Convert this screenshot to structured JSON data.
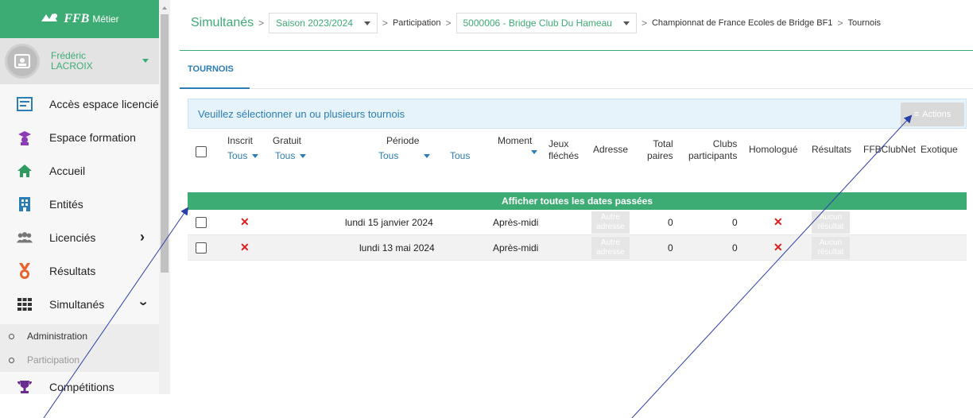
{
  "sidebar": {
    "brand": {
      "mark": "FFB",
      "sub": "Métier"
    },
    "user": {
      "first": "Frédéric",
      "last": "LACROIX"
    },
    "items": [
      {
        "label": "Accès espace licencié"
      },
      {
        "label": "Espace formation"
      },
      {
        "label": "Accueil"
      },
      {
        "label": "Entités"
      },
      {
        "label": "Licenciés"
      },
      {
        "label": "Résultats"
      },
      {
        "label": "Simultanés"
      }
    ],
    "sub": [
      {
        "label": "Administration"
      },
      {
        "label": "Participation"
      }
    ],
    "last": {
      "label": "Compétitions"
    },
    "colors": {
      "brand": "#3dac74",
      "blue": "#2a7db5"
    }
  },
  "breadcrumb": {
    "title": "Simultanés",
    "season": "Saison 2023/2024",
    "participation": "Participation",
    "club": "5000006 - Bridge Club Du Hameau",
    "championship": "Championnat de France Ecoles de Bridge BF1",
    "tournois": "Tournois"
  },
  "tabs": {
    "active": "TOURNOIS"
  },
  "info": {
    "message": "Veuillez sélectionner un ou plusieurs tournois",
    "actions": "Actions"
  },
  "table": {
    "headers": {
      "inscrit": "Inscrit",
      "gratuit": "Gratuit",
      "periode": "Période",
      "moment": "Moment",
      "jeux1": "Jeux",
      "jeux2": "fléchés",
      "adresse": "Adresse",
      "total1": "Total",
      "total2": "paires",
      "clubs1": "Clubs",
      "clubs2": "participants",
      "homologue": "Homologué",
      "resultats": "Résultats",
      "ffbclubnet": "FFBClubNet",
      "exotique": "Exotique"
    },
    "filters": {
      "inscrit": "Tous",
      "gratuit": "Tous",
      "periode_from": "Tous",
      "periode_to": "Tous"
    },
    "show_past": "Afficher toutes les dates passées",
    "rows": [
      {
        "date": "lundi 15 janvier 2024",
        "moment": "Après-midi",
        "adresse": "Autre adresse",
        "total": "0",
        "clubs": "0",
        "resultat": "Aucun résultat"
      },
      {
        "date": "lundi 13 mai 2024",
        "moment": "Après-midi",
        "adresse": "Autre adresse",
        "total": "0",
        "clubs": "0",
        "resultat": "Aucun résultat"
      }
    ]
  }
}
